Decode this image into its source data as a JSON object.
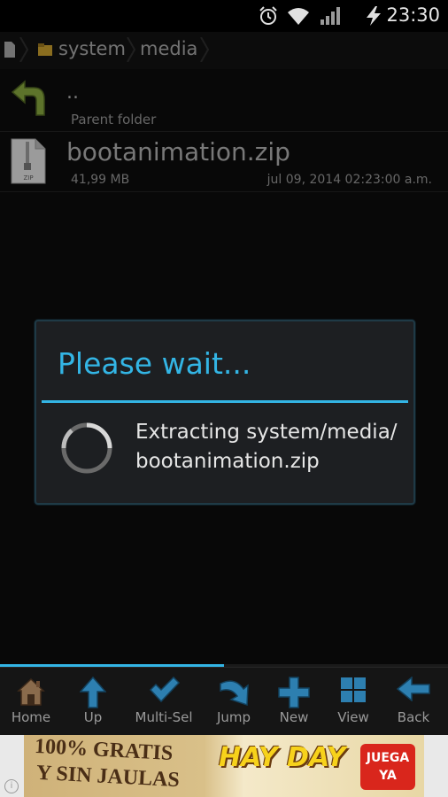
{
  "status_bar": {
    "time": "23:30"
  },
  "breadcrumb": {
    "items": [
      {
        "label": "system"
      },
      {
        "label": "media"
      }
    ]
  },
  "list": {
    "parent": {
      "name": "..",
      "label": "Parent folder"
    },
    "file": {
      "name": "bootanimation.zip",
      "size": "41,99 MB",
      "date": "jul 09, 2014 02:23:00 a.m.",
      "icon_text": "ZIP"
    }
  },
  "dialog": {
    "title": "Please wait...",
    "message": "Extracting system/media/bootanimation.zip",
    "message_line1": "Extracting system/media/",
    "message_line2": "bootanimation.zip"
  },
  "progress": {
    "fraction": 0.5
  },
  "toolbar": {
    "items": [
      {
        "label": "Home"
      },
      {
        "label": "Up"
      },
      {
        "label": "Multi-Sel"
      },
      {
        "label": "Jump"
      },
      {
        "label": "New"
      },
      {
        "label": "View"
      },
      {
        "label": "Back"
      }
    ]
  },
  "ad": {
    "line1": "100% GRATIS",
    "line2": "Y SIN JAULAS",
    "logo": "HAY DAY",
    "cta": "JUEGA YA",
    "info": "i"
  },
  "colors": {
    "accent": "#33b5e5"
  }
}
